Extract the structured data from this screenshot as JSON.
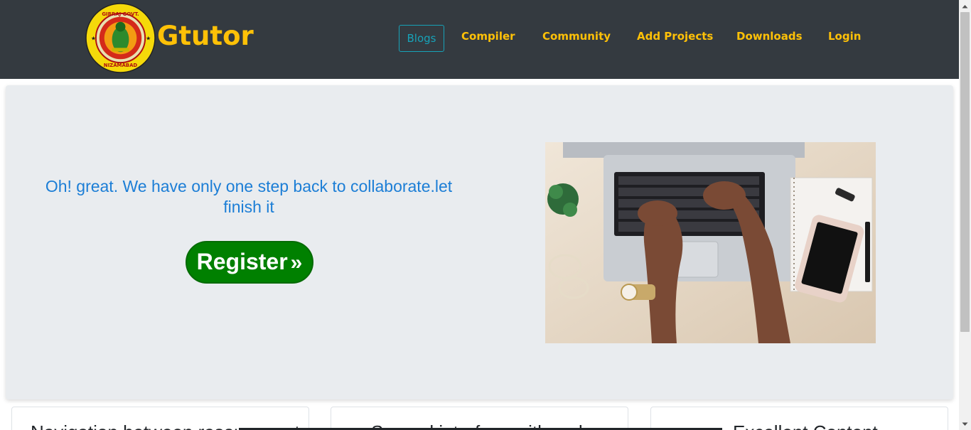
{
  "brand": {
    "name": "Gtutor",
    "logo_text_top": "GIRRAJ GOVT. COLLEGE",
    "logo_text_sub": "AUTONOMOUS",
    "logo_text_bottom": "NIZAMABAD (T.S.)"
  },
  "nav": {
    "items": [
      {
        "label": "Blogs",
        "active": true
      },
      {
        "label": "Compiler"
      },
      {
        "label": "Community"
      },
      {
        "label": "Add Projects"
      },
      {
        "label": "Downloads"
      },
      {
        "label": "Login"
      }
    ]
  },
  "hero": {
    "message": "Oh! great. We have only one step back to collaborate.let finish it",
    "register_label": "Register",
    "register_icon": "double-chevron-right-icon",
    "image_alt": "laptop-typing-photo"
  },
  "cards": [
    {
      "title": "Navigation between resources at"
    },
    {
      "title": "Several interface with code"
    },
    {
      "title": "Excellent Content"
    }
  ],
  "colors": {
    "navbar_bg": "#343a40",
    "accent_yellow": "#ffc107",
    "active_teal": "#17a2b8",
    "message_blue": "#1c7ed6",
    "register_green": "#008000",
    "jumbotron_bg": "#e9ecef"
  }
}
